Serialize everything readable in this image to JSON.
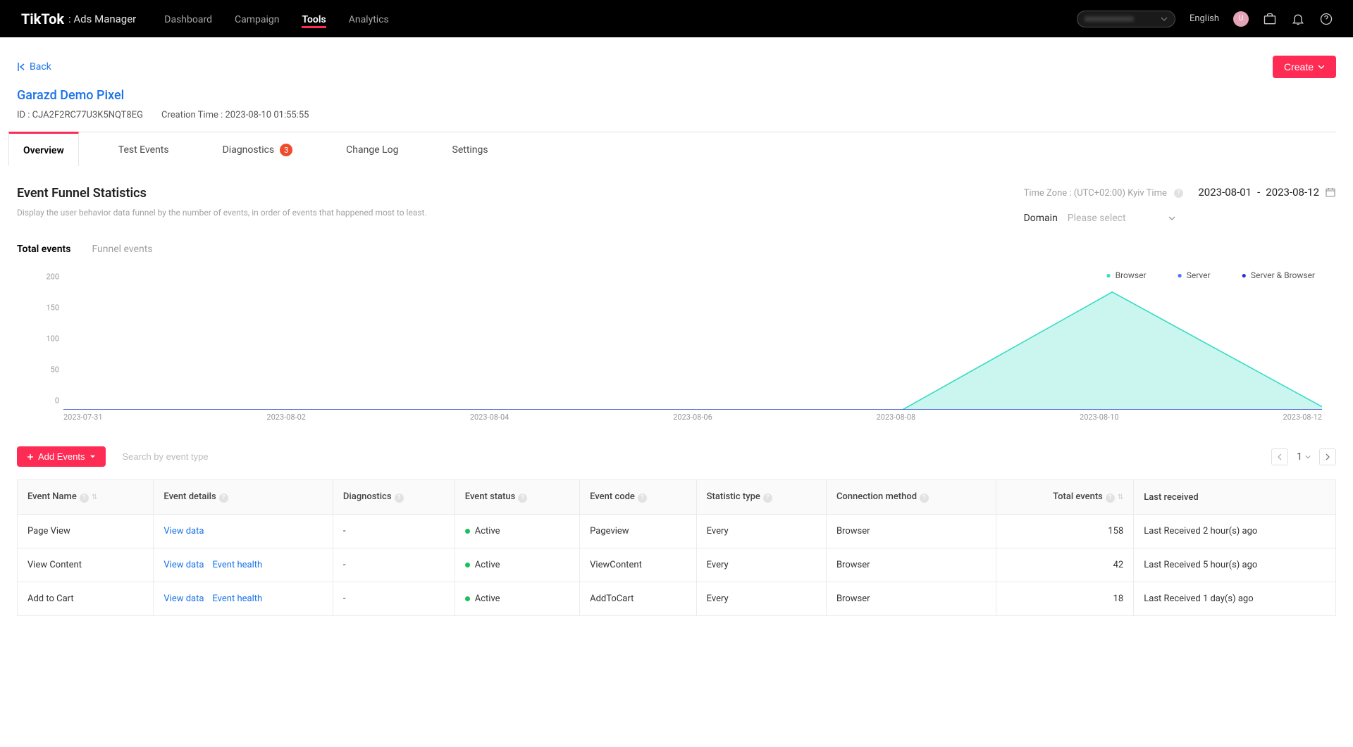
{
  "topnav": {
    "brand_main": "TikTok",
    "brand_sub": ": Ads Manager",
    "items": [
      "Dashboard",
      "Campaign",
      "Tools",
      "Analytics"
    ],
    "active_index": 2,
    "language": "English",
    "avatar_initial": "U"
  },
  "header": {
    "back_label": "Back",
    "create_label": "Create",
    "pixel_name": "Garazd Demo Pixel",
    "id_label": "ID : CJA2F2RC77U3K5NQT8EG",
    "ctime_label": "Creation Time : 2023-08-10 01:55:55"
  },
  "tabs": {
    "items": [
      {
        "label": "Overview",
        "badge": null
      },
      {
        "label": "Test Events",
        "badge": null
      },
      {
        "label": "Diagnostics",
        "badge": "3"
      },
      {
        "label": "Change Log",
        "badge": null
      },
      {
        "label": "Settings",
        "badge": null
      }
    ],
    "active_index": 0
  },
  "stats": {
    "title": "Event Funnel Statistics",
    "desc": "Display the user behavior data funnel by the number of events, in order of events that happened most to least.",
    "tz_label": "Time Zone : (UTC+02:00) Kyiv Time",
    "date_from": "2023-08-01",
    "date_to": "2023-08-12",
    "date_sep": "-",
    "domain_label": "Domain",
    "domain_placeholder": "Please select"
  },
  "subtabs": {
    "items": [
      "Total events",
      "Funnel events"
    ],
    "active_index": 0
  },
  "legend": {
    "browser": "Browser",
    "server": "Server",
    "both": "Server & Browser"
  },
  "chart_data": {
    "type": "area",
    "title": "",
    "xlabel": "",
    "ylabel": "",
    "ylim": [
      0,
      200
    ],
    "yticks": [
      0,
      50,
      100,
      150,
      200
    ],
    "x": [
      "2023-07-31",
      "2023-08-02",
      "2023-08-04",
      "2023-08-06",
      "2023-08-08",
      "2023-08-10",
      "2023-08-12"
    ],
    "series": [
      {
        "name": "Browser",
        "color": "#37dcc6",
        "values": [
          0,
          0,
          0,
          0,
          0,
          190,
          5
        ]
      },
      {
        "name": "Server",
        "color": "#4a77ff",
        "values": [
          0,
          0,
          0,
          0,
          0,
          0,
          0
        ]
      },
      {
        "name": "Server & Browser",
        "color": "#2a32d4",
        "values": [
          0,
          0,
          0,
          0,
          0,
          0,
          0
        ]
      }
    ]
  },
  "table": {
    "add_btn": "Add Events",
    "search_placeholder": "Search by event type",
    "page": "1",
    "columns": [
      "Event Name",
      "Event details",
      "Diagnostics",
      "Event status",
      "Event code",
      "Statistic type",
      "Connection method",
      "Total events",
      "Last received"
    ],
    "rows": [
      {
        "name": "Page View",
        "details": [
          "View data"
        ],
        "diag": "-",
        "status": "Active",
        "code": "Pageview",
        "stat": "Every",
        "conn": "Browser",
        "total": "158",
        "last": "Last Received 2 hour(s) ago"
      },
      {
        "name": "View Content",
        "details": [
          "View data",
          "Event health"
        ],
        "diag": "-",
        "status": "Active",
        "code": "ViewContent",
        "stat": "Every",
        "conn": "Browser",
        "total": "42",
        "last": "Last Received 5 hour(s) ago"
      },
      {
        "name": "Add to Cart",
        "details": [
          "View data",
          "Event health"
        ],
        "diag": "-",
        "status": "Active",
        "code": "AddToCart",
        "stat": "Every",
        "conn": "Browser",
        "total": "18",
        "last": "Last Received 1 day(s) ago"
      }
    ]
  }
}
